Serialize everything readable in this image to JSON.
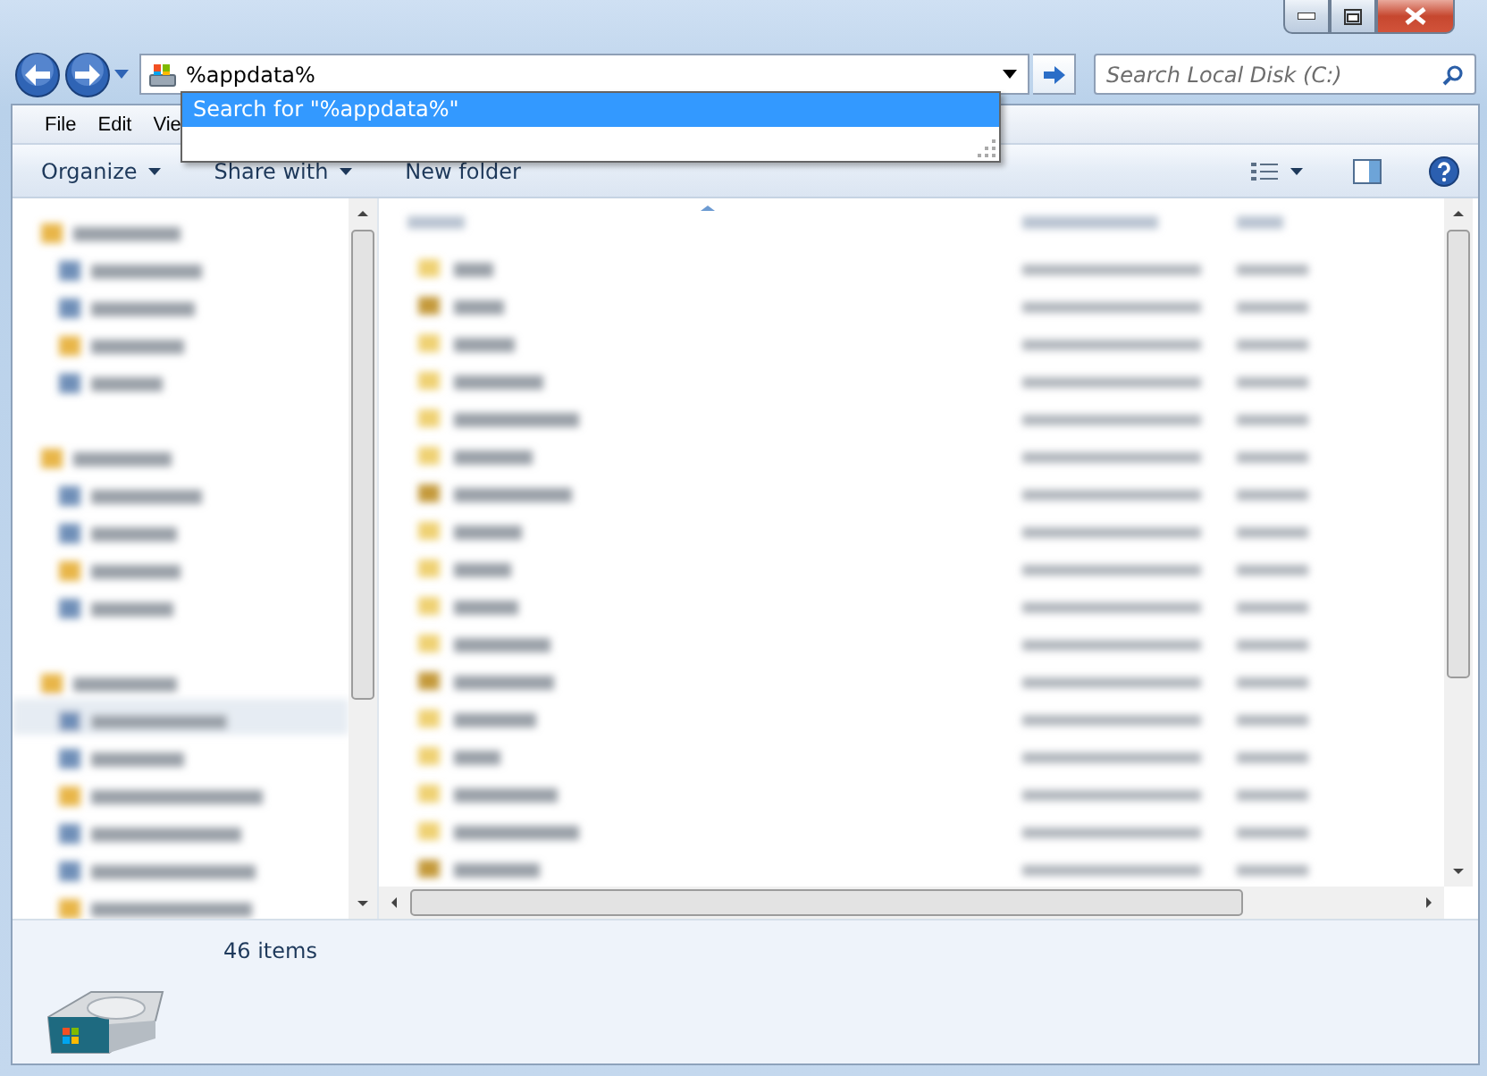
{
  "address": {
    "value": "%appdata%"
  },
  "search": {
    "placeholder": "Search Local Disk (C:)"
  },
  "autocomplete": [
    {
      "label": "Search for \"%appdata%\"",
      "selected": true
    }
  ],
  "menu": [
    "File",
    "Edit",
    "Vie"
  ],
  "toolbar": [
    {
      "label": "Organize",
      "dropdown": true
    },
    {
      "label": "Share with",
      "dropdown": true
    },
    {
      "label": "New folder",
      "dropdown": false
    }
  ],
  "status": {
    "item_count": "46 items"
  }
}
